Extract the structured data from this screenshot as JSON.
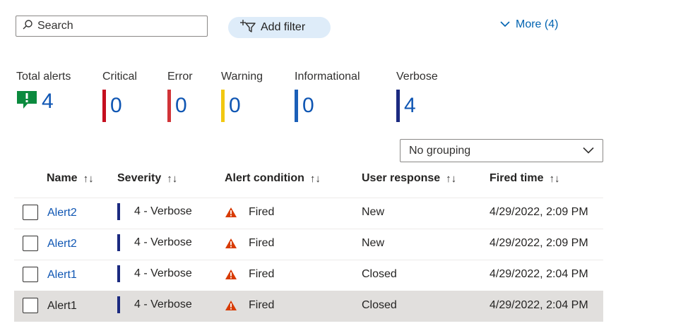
{
  "toolbar": {
    "search_placeholder": "Search",
    "add_filter_label": "Add filter",
    "more_label": "More (4)"
  },
  "summary": {
    "total": {
      "label": "Total alerts",
      "value": "4"
    },
    "critical": {
      "label": "Critical",
      "value": "0",
      "color": "#c50f1f"
    },
    "error": {
      "label": "Error",
      "value": "0",
      "color": "#d13438"
    },
    "warning": {
      "label": "Warning",
      "value": "0",
      "color": "#f2c811"
    },
    "informational": {
      "label": "Informational",
      "value": "0",
      "color": "#1b5fb8"
    },
    "verbose": {
      "label": "Verbose",
      "value": "4",
      "color": "#1b2a80"
    }
  },
  "grouping": {
    "selected": "No grouping"
  },
  "table": {
    "columns": [
      "Name",
      "Severity",
      "Alert condition",
      "User response",
      "Fired time"
    ],
    "sort_glyph": "↑↓",
    "rows": [
      {
        "name": "Alert2",
        "severity": "4 - Verbose",
        "condition": "Fired",
        "response": "New",
        "fired": "4/29/2022, 2:09 PM"
      },
      {
        "name": "Alert2",
        "severity": "4 - Verbose",
        "condition": "Fired",
        "response": "New",
        "fired": "4/29/2022, 2:09 PM"
      },
      {
        "name": "Alert1",
        "severity": "4 - Verbose",
        "condition": "Fired",
        "response": "Closed",
        "fired": "4/29/2022, 2:04 PM"
      },
      {
        "name": "Alert1",
        "severity": "4 - Verbose",
        "condition": "Fired",
        "response": "Closed",
        "fired": "4/29/2022, 2:04 PM"
      }
    ]
  },
  "icons": {
    "search": "search-icon",
    "filter": "add-filter-icon",
    "more": "chevron-down-icon",
    "total": "alert-icon",
    "condition": "warning-icon"
  },
  "colors": {
    "accent": "#0f56b3",
    "verbose": "#1b2a80",
    "warning_icon": "#d83b01",
    "selected_row": "#e1dfdd"
  }
}
